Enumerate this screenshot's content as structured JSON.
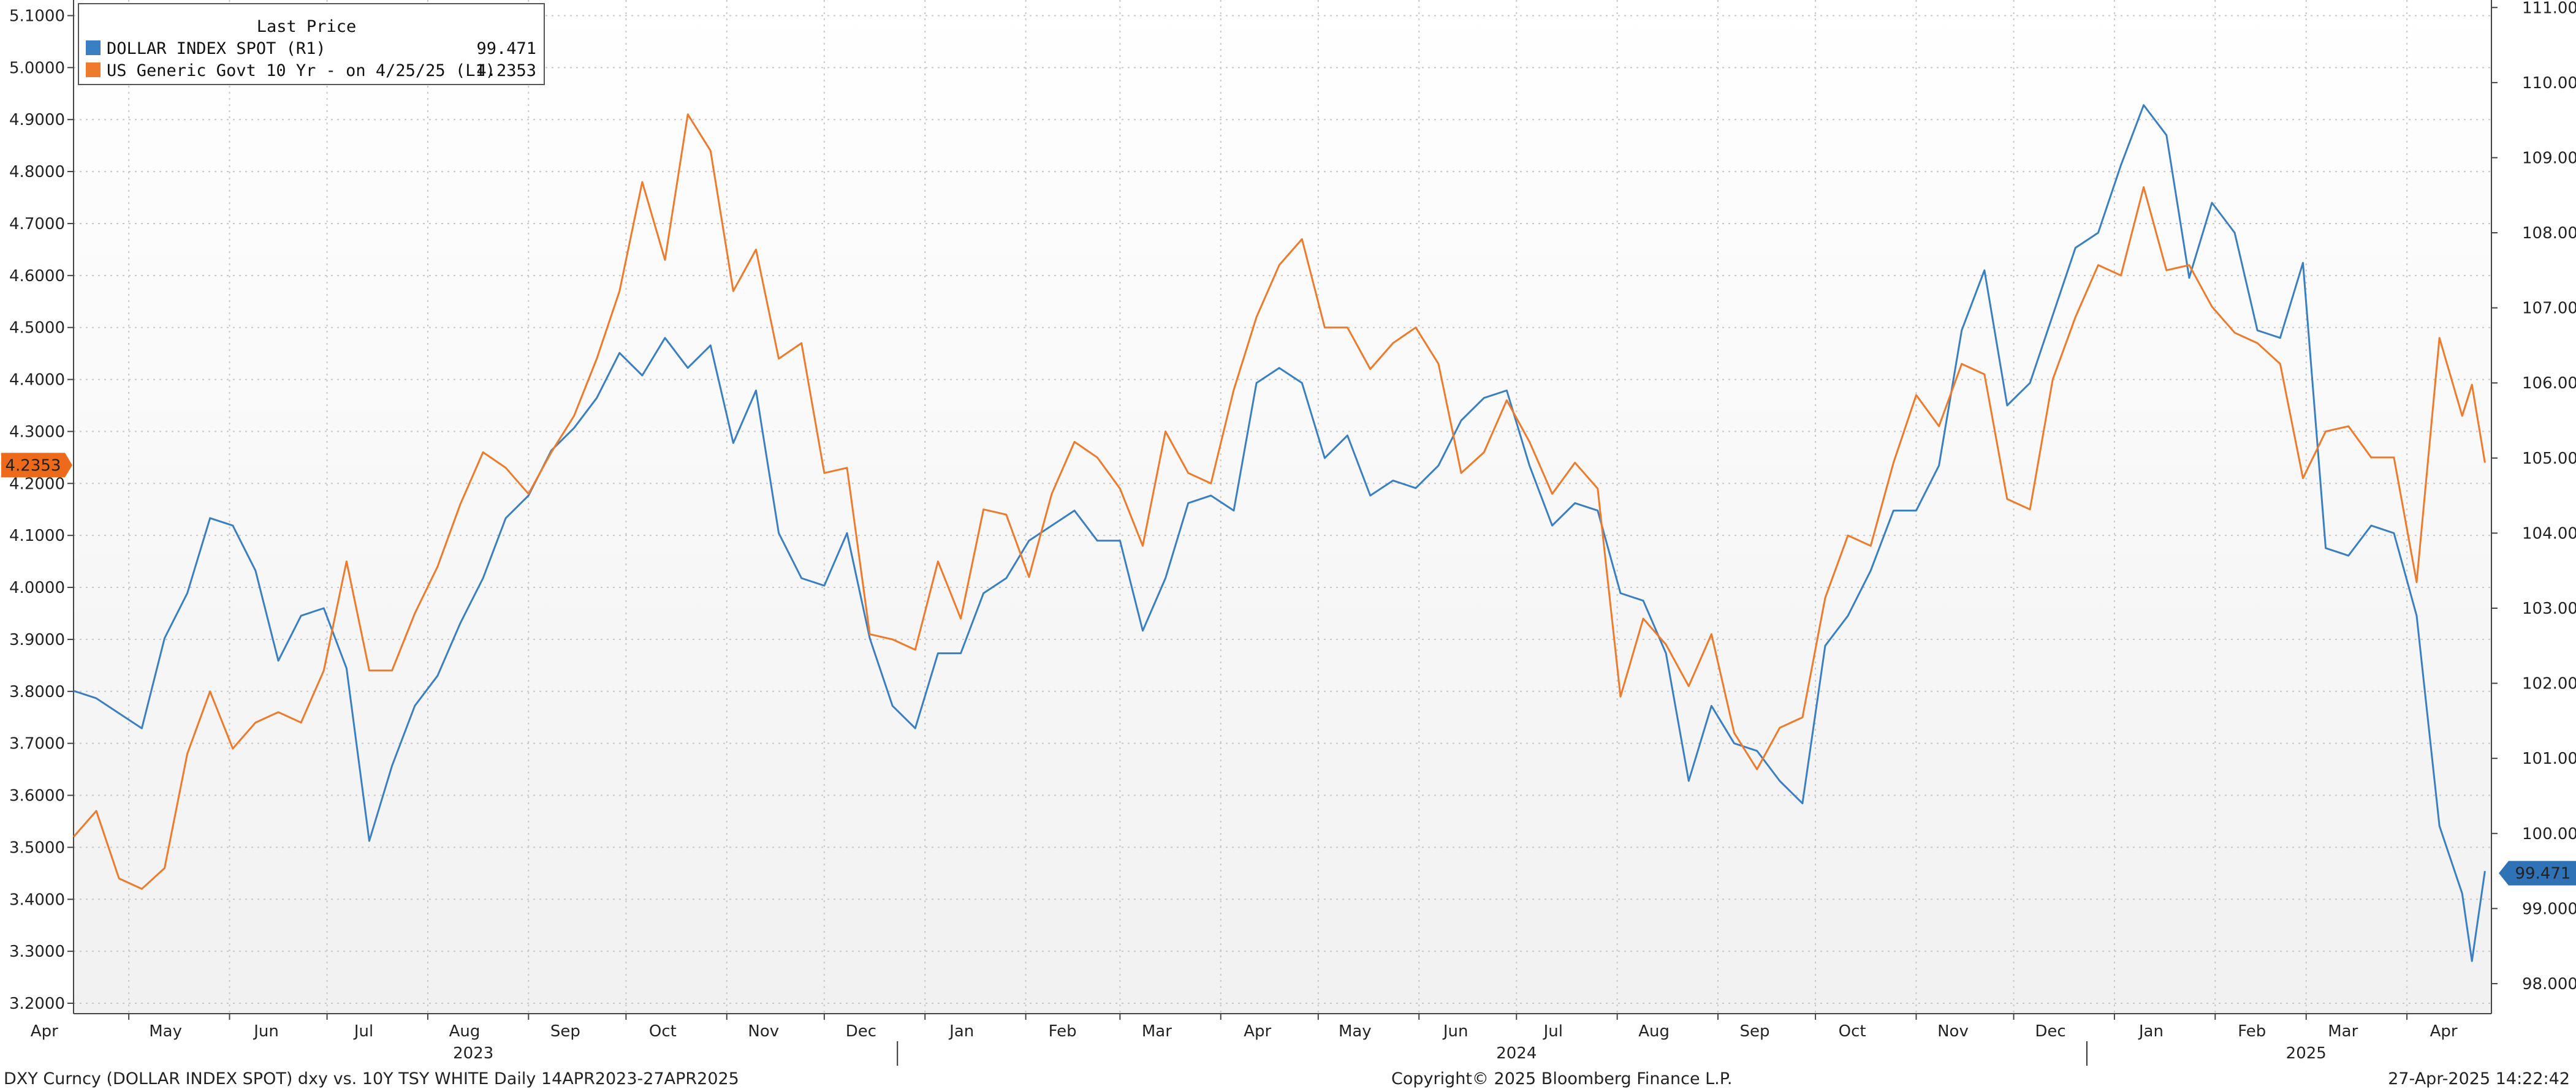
{
  "chart_data": {
    "type": "line",
    "legend": {
      "title": "Last Price",
      "placement": "top-left",
      "entries": [
        {
          "label": "DOLLAR INDEX SPOT  (R1)",
          "value": "99.471"
        },
        {
          "label": "US Generic Govt 10 Yr -  on 4/25/25  (L1)",
          "value": "4.2353"
        }
      ]
    },
    "left_axis": {
      "ylim": [
        3.18,
        5.13
      ],
      "ticks": [
        "3.2000",
        "3.3000",
        "3.4000",
        "3.5000",
        "3.6000",
        "3.7000",
        "3.8000",
        "3.9000",
        "4.0000",
        "4.1000",
        "4.2000",
        "4.3000",
        "4.4000",
        "4.5000",
        "4.6000",
        "4.7000",
        "4.8000",
        "4.9000",
        "5.0000",
        "5.1000"
      ],
      "last_value_label": "4.2353"
    },
    "right_axis": {
      "ylim": [
        97.6,
        111.1
      ],
      "ticks": [
        "98.000",
        "99.000",
        "100.000",
        "101.000",
        "102.000",
        "103.000",
        "104.000",
        "105.000",
        "106.000",
        "107.000",
        "108.000",
        "109.000",
        "110.000",
        "111.000"
      ],
      "last_value_label": "99.471"
    },
    "x_axis": {
      "range": [
        "2023-04-14",
        "2025-04-27"
      ],
      "month_labels": [
        {
          "date": "2023-04-05",
          "label": "Apr"
        },
        {
          "date": "2023-05-01",
          "label": "May"
        },
        {
          "date": "2023-06-01",
          "label": "Jun"
        },
        {
          "date": "2023-07-01",
          "label": "Jul"
        },
        {
          "date": "2023-08-01",
          "label": "Aug"
        },
        {
          "date": "2023-09-01",
          "label": "Sep"
        },
        {
          "date": "2023-10-01",
          "label": "Oct"
        },
        {
          "date": "2023-11-01",
          "label": "Nov"
        },
        {
          "date": "2023-12-01",
          "label": "Dec"
        },
        {
          "date": "2024-01-01",
          "label": "Jan"
        },
        {
          "date": "2024-02-01",
          "label": "Feb"
        },
        {
          "date": "2024-03-01",
          "label": "Mar"
        },
        {
          "date": "2024-04-01",
          "label": "Apr"
        },
        {
          "date": "2024-05-01",
          "label": "May"
        },
        {
          "date": "2024-06-01",
          "label": "Jun"
        },
        {
          "date": "2024-07-01",
          "label": "Jul"
        },
        {
          "date": "2024-08-01",
          "label": "Aug"
        },
        {
          "date": "2024-09-01",
          "label": "Sep"
        },
        {
          "date": "2024-10-01",
          "label": "Oct"
        },
        {
          "date": "2024-11-01",
          "label": "Nov"
        },
        {
          "date": "2024-12-01",
          "label": "Dec"
        },
        {
          "date": "2025-01-01",
          "label": "Jan"
        },
        {
          "date": "2025-02-01",
          "label": "Feb"
        },
        {
          "date": "2025-03-01",
          "label": "Mar"
        },
        {
          "date": "2025-04-01",
          "label": "Apr"
        }
      ],
      "year_labels": [
        {
          "date": "2023-08-15",
          "label": "2023"
        },
        {
          "date": "2024-07-01",
          "label": "2024"
        },
        {
          "date": "2025-03-01",
          "label": "2025"
        }
      ],
      "year_dividers": [
        "2024-01-01",
        "2025-01-01"
      ]
    },
    "grid": true,
    "series": [
      {
        "name": "DOLLAR INDEX SPOT",
        "axis": "right",
        "color": "#3a7fc1",
        "points": [
          [
            "2023-04-14",
            101.9
          ],
          [
            "2023-04-21",
            101.8
          ],
          [
            "2023-04-28",
            101.6
          ],
          [
            "2023-05-05",
            101.4
          ],
          [
            "2023-05-12",
            102.6
          ],
          [
            "2023-05-19",
            103.2
          ],
          [
            "2023-05-26",
            104.2
          ],
          [
            "2023-06-02",
            104.1
          ],
          [
            "2023-06-09",
            103.5
          ],
          [
            "2023-06-16",
            102.3
          ],
          [
            "2023-06-23",
            102.9
          ],
          [
            "2023-06-30",
            103.0
          ],
          [
            "2023-07-07",
            102.2
          ],
          [
            "2023-07-14",
            99.9
          ],
          [
            "2023-07-21",
            100.9
          ],
          [
            "2023-07-28",
            101.7
          ],
          [
            "2023-08-04",
            102.1
          ],
          [
            "2023-08-11",
            102.8
          ],
          [
            "2023-08-18",
            103.4
          ],
          [
            "2023-08-25",
            104.2
          ],
          [
            "2023-09-01",
            104.5
          ],
          [
            "2023-09-08",
            105.1
          ],
          [
            "2023-09-15",
            105.4
          ],
          [
            "2023-09-22",
            105.8
          ],
          [
            "2023-09-29",
            106.4
          ],
          [
            "2023-10-06",
            106.1
          ],
          [
            "2023-10-13",
            106.6
          ],
          [
            "2023-10-20",
            106.2
          ],
          [
            "2023-10-27",
            106.5
          ],
          [
            "2023-11-03",
            105.2
          ],
          [
            "2023-11-10",
            105.9
          ],
          [
            "2023-11-17",
            104.0
          ],
          [
            "2023-11-24",
            103.4
          ],
          [
            "2023-12-01",
            103.3
          ],
          [
            "2023-12-08",
            104.0
          ],
          [
            "2023-12-15",
            102.6
          ],
          [
            "2023-12-22",
            101.7
          ],
          [
            "2023-12-29",
            101.4
          ],
          [
            "2024-01-05",
            102.4
          ],
          [
            "2024-01-12",
            102.4
          ],
          [
            "2024-01-19",
            103.2
          ],
          [
            "2024-01-26",
            103.4
          ],
          [
            "2024-02-02",
            103.9
          ],
          [
            "2024-02-09",
            104.1
          ],
          [
            "2024-02-16",
            104.3
          ],
          [
            "2024-02-23",
            103.9
          ],
          [
            "2024-03-01",
            103.9
          ],
          [
            "2024-03-08",
            102.7
          ],
          [
            "2024-03-15",
            103.4
          ],
          [
            "2024-03-22",
            104.4
          ],
          [
            "2024-03-29",
            104.5
          ],
          [
            "2024-04-05",
            104.3
          ],
          [
            "2024-04-12",
            106.0
          ],
          [
            "2024-04-19",
            106.2
          ],
          [
            "2024-04-26",
            106.0
          ],
          [
            "2024-05-03",
            105.0
          ],
          [
            "2024-05-10",
            105.3
          ],
          [
            "2024-05-17",
            104.5
          ],
          [
            "2024-05-24",
            104.7
          ],
          [
            "2024-05-31",
            104.6
          ],
          [
            "2024-06-07",
            104.9
          ],
          [
            "2024-06-14",
            105.5
          ],
          [
            "2024-06-21",
            105.8
          ],
          [
            "2024-06-28",
            105.9
          ],
          [
            "2024-07-05",
            104.9
          ],
          [
            "2024-07-12",
            104.1
          ],
          [
            "2024-07-19",
            104.4
          ],
          [
            "2024-07-26",
            104.3
          ],
          [
            "2024-08-02",
            103.2
          ],
          [
            "2024-08-09",
            103.1
          ],
          [
            "2024-08-16",
            102.4
          ],
          [
            "2024-08-23",
            100.7
          ],
          [
            "2024-08-30",
            101.7
          ],
          [
            "2024-09-06",
            101.2
          ],
          [
            "2024-09-13",
            101.1
          ],
          [
            "2024-09-20",
            100.7
          ],
          [
            "2024-09-27",
            100.4
          ],
          [
            "2024-10-04",
            102.5
          ],
          [
            "2024-10-11",
            102.9
          ],
          [
            "2024-10-18",
            103.5
          ],
          [
            "2024-10-25",
            104.3
          ],
          [
            "2024-11-01",
            104.3
          ],
          [
            "2024-11-08",
            104.9
          ],
          [
            "2024-11-15",
            106.7
          ],
          [
            "2024-11-22",
            107.5
          ],
          [
            "2024-11-29",
            105.7
          ],
          [
            "2024-12-06",
            106.0
          ],
          [
            "2024-12-13",
            106.9
          ],
          [
            "2024-12-20",
            107.8
          ],
          [
            "2024-12-27",
            108.0
          ],
          [
            "2025-01-03",
            108.9
          ],
          [
            "2025-01-10",
            109.7
          ],
          [
            "2025-01-17",
            109.3
          ],
          [
            "2025-01-24",
            107.4
          ],
          [
            "2025-01-31",
            108.4
          ],
          [
            "2025-02-07",
            108.0
          ],
          [
            "2025-02-14",
            106.7
          ],
          [
            "2025-02-21",
            106.6
          ],
          [
            "2025-02-28",
            107.6
          ],
          [
            "2025-03-07",
            103.8
          ],
          [
            "2025-03-14",
            103.7
          ],
          [
            "2025-03-21",
            104.1
          ],
          [
            "2025-03-28",
            104.0
          ],
          [
            "2025-04-04",
            102.9
          ],
          [
            "2025-04-11",
            100.1
          ],
          [
            "2025-04-18",
            99.2
          ],
          [
            "2025-04-21",
            98.3
          ],
          [
            "2025-04-25",
            99.5
          ]
        ]
      },
      {
        "name": "US Generic Govt 10 Yr",
        "axis": "left",
        "color": "#ee7a2b",
        "points": [
          [
            "2023-04-14",
            3.52
          ],
          [
            "2023-04-21",
            3.57
          ],
          [
            "2023-04-28",
            3.44
          ],
          [
            "2023-05-05",
            3.42
          ],
          [
            "2023-05-12",
            3.46
          ],
          [
            "2023-05-19",
            3.68
          ],
          [
            "2023-05-26",
            3.8
          ],
          [
            "2023-06-02",
            3.69
          ],
          [
            "2023-06-09",
            3.74
          ],
          [
            "2023-06-16",
            3.76
          ],
          [
            "2023-06-23",
            3.74
          ],
          [
            "2023-06-30",
            3.84
          ],
          [
            "2023-07-07",
            4.05
          ],
          [
            "2023-07-14",
            3.84
          ],
          [
            "2023-07-21",
            3.84
          ],
          [
            "2023-07-28",
            3.95
          ],
          [
            "2023-08-04",
            4.04
          ],
          [
            "2023-08-11",
            4.16
          ],
          [
            "2023-08-18",
            4.26
          ],
          [
            "2023-08-25",
            4.23
          ],
          [
            "2023-09-01",
            4.18
          ],
          [
            "2023-09-08",
            4.26
          ],
          [
            "2023-09-15",
            4.33
          ],
          [
            "2023-09-22",
            4.44
          ],
          [
            "2023-09-29",
            4.57
          ],
          [
            "2023-10-06",
            4.78
          ],
          [
            "2023-10-13",
            4.63
          ],
          [
            "2023-10-20",
            4.91
          ],
          [
            "2023-10-27",
            4.84
          ],
          [
            "2023-11-03",
            4.57
          ],
          [
            "2023-11-10",
            4.65
          ],
          [
            "2023-11-17",
            4.44
          ],
          [
            "2023-11-24",
            4.47
          ],
          [
            "2023-12-01",
            4.22
          ],
          [
            "2023-12-08",
            4.23
          ],
          [
            "2023-12-15",
            3.91
          ],
          [
            "2023-12-22",
            3.9
          ],
          [
            "2023-12-29",
            3.88
          ],
          [
            "2024-01-05",
            4.05
          ],
          [
            "2024-01-12",
            3.94
          ],
          [
            "2024-01-19",
            4.15
          ],
          [
            "2024-01-26",
            4.14
          ],
          [
            "2024-02-02",
            4.02
          ],
          [
            "2024-02-09",
            4.18
          ],
          [
            "2024-02-16",
            4.28
          ],
          [
            "2024-02-23",
            4.25
          ],
          [
            "2024-03-01",
            4.19
          ],
          [
            "2024-03-08",
            4.08
          ],
          [
            "2024-03-15",
            4.3
          ],
          [
            "2024-03-22",
            4.22
          ],
          [
            "2024-03-29",
            4.2
          ],
          [
            "2024-04-05",
            4.38
          ],
          [
            "2024-04-12",
            4.52
          ],
          [
            "2024-04-19",
            4.62
          ],
          [
            "2024-04-26",
            4.67
          ],
          [
            "2024-05-03",
            4.5
          ],
          [
            "2024-05-10",
            4.5
          ],
          [
            "2024-05-17",
            4.42
          ],
          [
            "2024-05-24",
            4.47
          ],
          [
            "2024-05-31",
            4.5
          ],
          [
            "2024-06-07",
            4.43
          ],
          [
            "2024-06-14",
            4.22
          ],
          [
            "2024-06-21",
            4.26
          ],
          [
            "2024-06-28",
            4.36
          ],
          [
            "2024-07-05",
            4.28
          ],
          [
            "2024-07-12",
            4.18
          ],
          [
            "2024-07-19",
            4.24
          ],
          [
            "2024-07-26",
            4.19
          ],
          [
            "2024-08-02",
            3.79
          ],
          [
            "2024-08-09",
            3.94
          ],
          [
            "2024-08-16",
            3.89
          ],
          [
            "2024-08-23",
            3.81
          ],
          [
            "2024-08-30",
            3.91
          ],
          [
            "2024-09-06",
            3.72
          ],
          [
            "2024-09-13",
            3.65
          ],
          [
            "2024-09-20",
            3.73
          ],
          [
            "2024-09-27",
            3.75
          ],
          [
            "2024-10-04",
            3.98
          ],
          [
            "2024-10-11",
            4.1
          ],
          [
            "2024-10-18",
            4.08
          ],
          [
            "2024-10-25",
            4.24
          ],
          [
            "2024-11-01",
            4.37
          ],
          [
            "2024-11-08",
            4.31
          ],
          [
            "2024-11-15",
            4.43
          ],
          [
            "2024-11-22",
            4.41
          ],
          [
            "2024-11-29",
            4.17
          ],
          [
            "2024-12-06",
            4.15
          ],
          [
            "2024-12-13",
            4.4
          ],
          [
            "2024-12-20",
            4.52
          ],
          [
            "2024-12-27",
            4.62
          ],
          [
            "2025-01-03",
            4.6
          ],
          [
            "2025-01-10",
            4.77
          ],
          [
            "2025-01-17",
            4.61
          ],
          [
            "2025-01-24",
            4.62
          ],
          [
            "2025-01-31",
            4.54
          ],
          [
            "2025-02-07",
            4.49
          ],
          [
            "2025-02-14",
            4.47
          ],
          [
            "2025-02-21",
            4.43
          ],
          [
            "2025-02-28",
            4.21
          ],
          [
            "2025-03-07",
            4.3
          ],
          [
            "2025-03-14",
            4.31
          ],
          [
            "2025-03-21",
            4.25
          ],
          [
            "2025-03-28",
            4.25
          ],
          [
            "2025-04-04",
            4.01
          ],
          [
            "2025-04-11",
            4.48
          ],
          [
            "2025-04-18",
            4.33
          ],
          [
            "2025-04-21",
            4.39
          ],
          [
            "2025-04-25",
            4.24
          ]
        ]
      }
    ]
  },
  "footer": {
    "left": "DXY Curncy (DOLLAR INDEX SPOT) dxy vs. 10Y TSY WHITE  Daily 14APR2023-27APR2025",
    "center": "Copyright© 2025 Bloomberg Finance L.P.",
    "right": "27-Apr-2025 14:22:42"
  }
}
